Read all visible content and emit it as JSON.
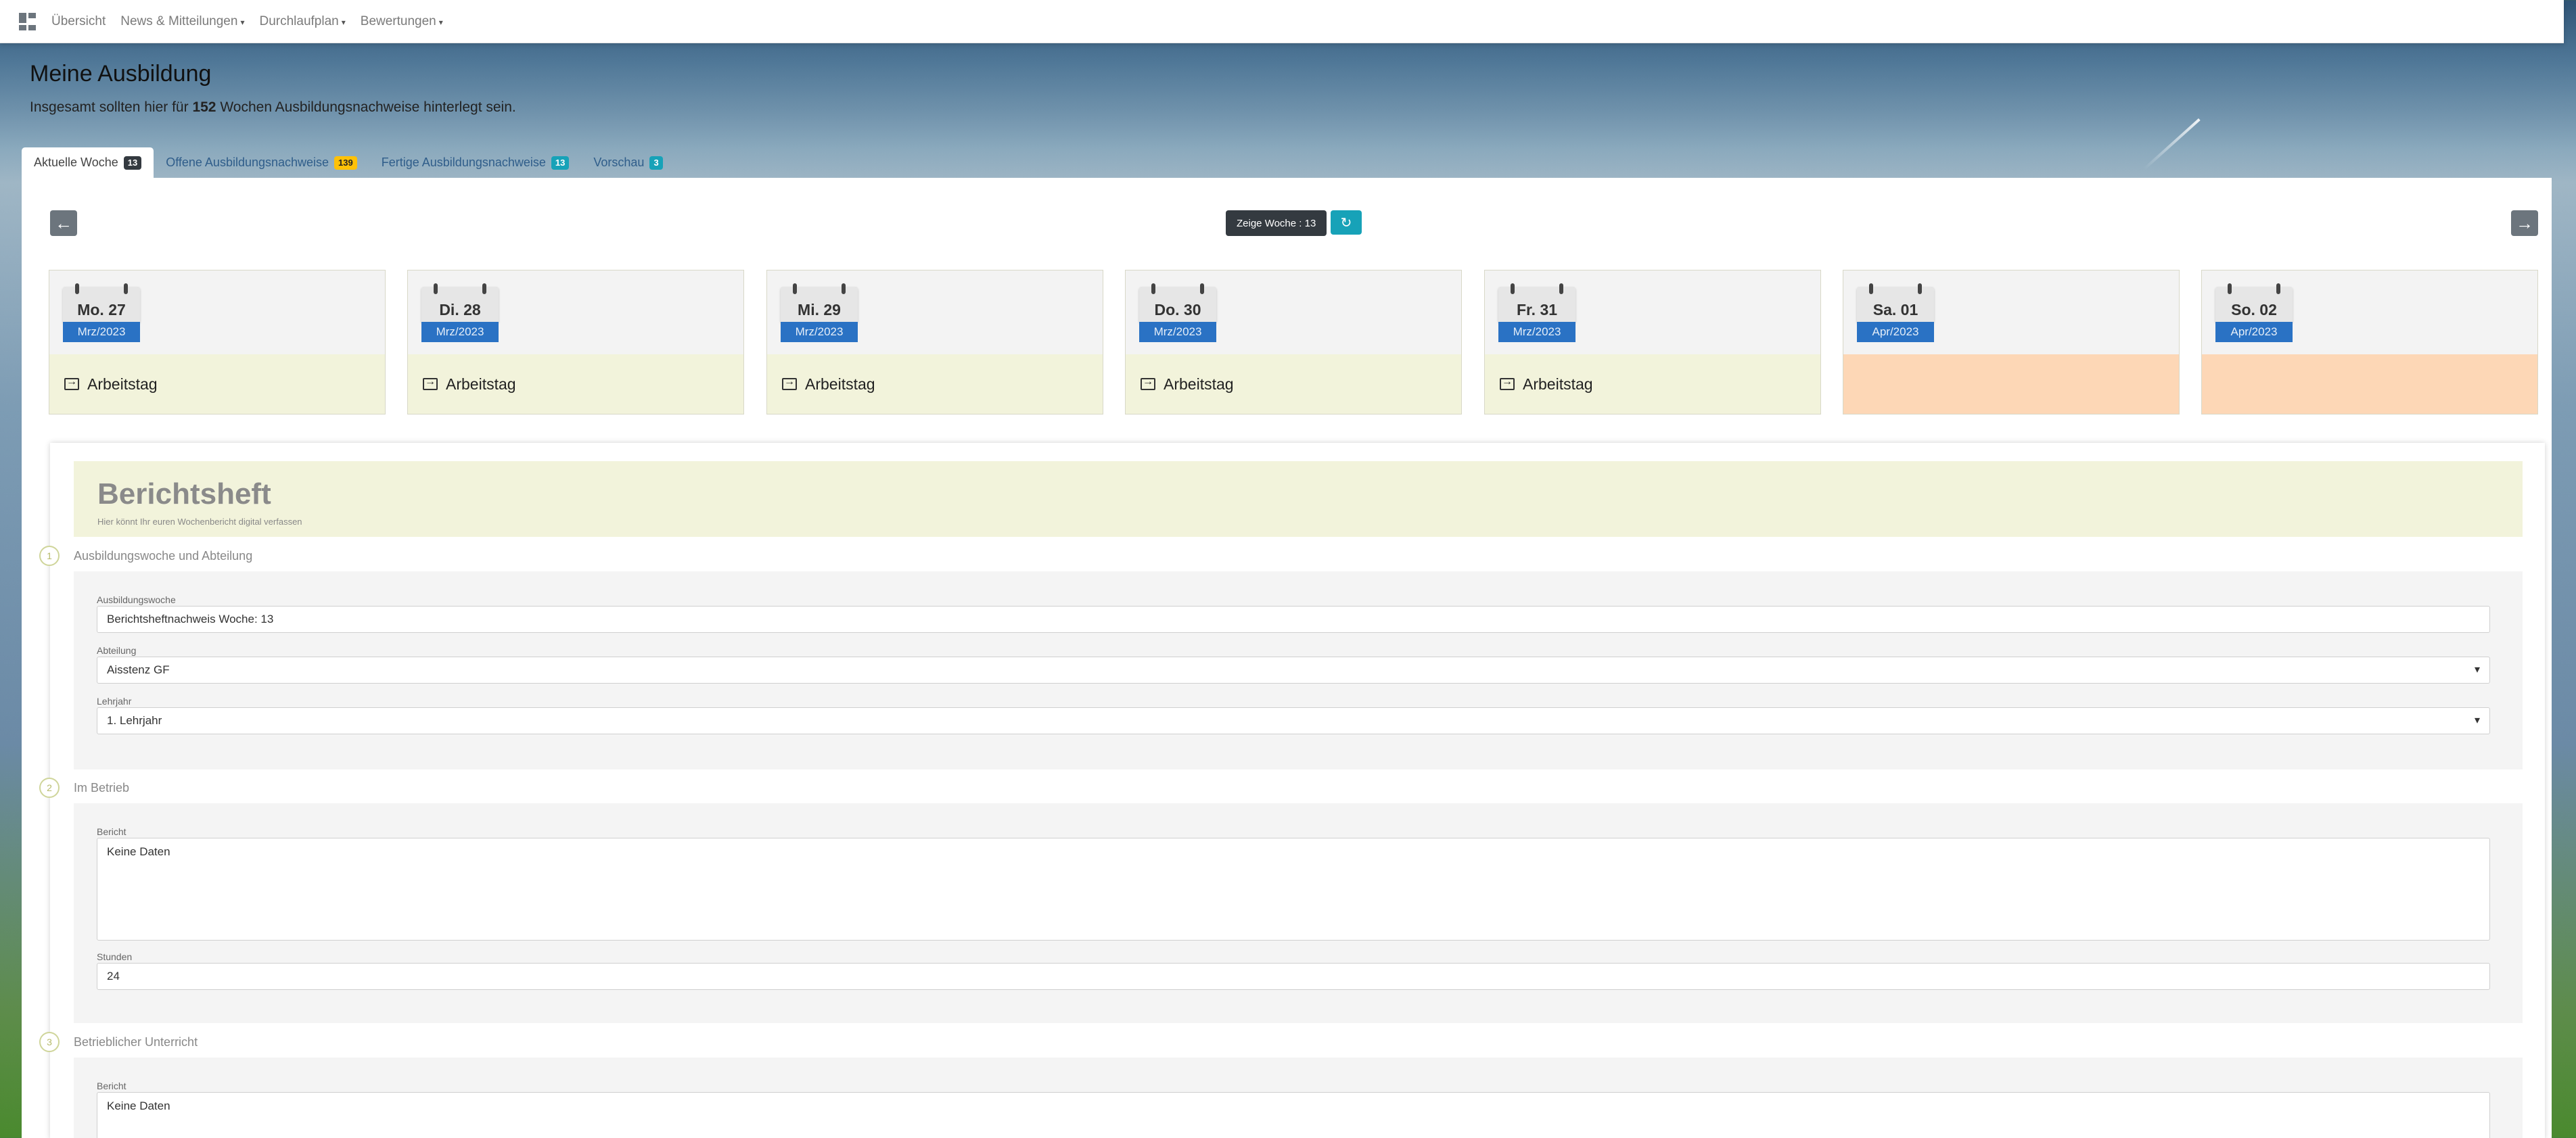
{
  "nav": {
    "items": [
      {
        "label": "Übersicht",
        "dropdown": false
      },
      {
        "label": "News & Mitteilungen",
        "dropdown": true
      },
      {
        "label": "Durchlaufplan",
        "dropdown": true
      },
      {
        "label": "Bewertungen",
        "dropdown": true
      }
    ]
  },
  "header": {
    "title": "Meine Ausbildung",
    "subtitle_prefix": "Insgesamt sollten hier für",
    "subtitle_count": "152",
    "subtitle_suffix": "Wochen Ausbildungsnachweise hinterlegt sein."
  },
  "tabs": [
    {
      "label": "Aktuelle Woche",
      "badge": "13",
      "active": true
    },
    {
      "label": "Offene Ausbildungsnachweise",
      "badge": "139",
      "active": false
    },
    {
      "label": "Fertige Ausbildungsnachweise",
      "badge": "13",
      "active": false
    },
    {
      "label": "Vorschau",
      "badge": "3",
      "active": false
    }
  ],
  "weeknav": {
    "prev_icon": "arrow-left-icon",
    "next_icon": "arrow-right-icon",
    "week_label": "Zeige Woche : 13",
    "refresh_icon": "refresh-icon"
  },
  "days": [
    {
      "day": "Mo. 27",
      "month": "Mrz/2023",
      "status": "Arbeitstag",
      "weekend": false
    },
    {
      "day": "Di. 28",
      "month": "Mrz/2023",
      "status": "Arbeitstag",
      "weekend": false
    },
    {
      "day": "Mi. 29",
      "month": "Mrz/2023",
      "status": "Arbeitstag",
      "weekend": false
    },
    {
      "day": "Do. 30",
      "month": "Mrz/2023",
      "status": "Arbeitstag",
      "weekend": false
    },
    {
      "day": "Fr. 31",
      "month": "Mrz/2023",
      "status": "Arbeitstag",
      "weekend": false
    },
    {
      "day": "Sa. 01",
      "month": "Apr/2023",
      "status": "",
      "weekend": true
    },
    {
      "day": "So. 02",
      "month": "Apr/2023",
      "status": "",
      "weekend": true
    }
  ],
  "berichtsheft": {
    "title": "Berichtsheft",
    "subtitle": "Hier könnt Ihr euren Wochenbericht digital verfassen",
    "sections": [
      {
        "number": "1",
        "label": "Ausbildungswoche und Abteilung",
        "fields": [
          {
            "label": "Ausbildungswoche",
            "value": "Berichtsheftnachweis Woche: 13"
          },
          {
            "label": "Abteilung",
            "value": "Aisstenz GF"
          },
          {
            "label": "Lehrjahr",
            "value": "1. Lehrjahr"
          }
        ]
      },
      {
        "number": "2",
        "label": "Im Betrieb",
        "fields": [
          {
            "label": "Bericht",
            "value": "Keine Daten"
          },
          {
            "label": "Stunden",
            "value": "24"
          }
        ]
      },
      {
        "number": "3",
        "label": "Betrieblicher Unterricht",
        "fields": [
          {
            "label": "Bericht",
            "value": "Keine Daten"
          }
        ]
      }
    ]
  },
  "colors": {
    "nav_bg": "#ffffff",
    "accent_info": "#17a2b8",
    "badge_warning": "#ffc107",
    "workday_bg": "#f2f3db",
    "weekend_bg": "#fdd7b6",
    "calendar_blue": "#2a72c4"
  }
}
